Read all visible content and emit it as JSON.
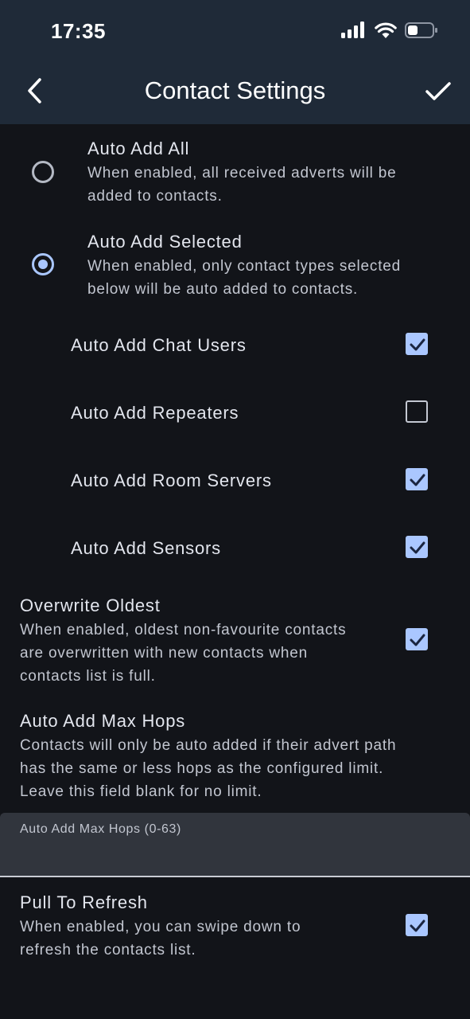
{
  "status_bar": {
    "time": "17:35"
  },
  "header": {
    "title": "Contact Settings",
    "back_icon": "chevron-left-icon",
    "confirm_icon": "checkmark-icon"
  },
  "auto_add_mode": {
    "selected": "auto_add_selected",
    "options": [
      {
        "title": "Auto Add All",
        "desc_line1": "When enabled, all received adverts will be",
        "desc_line2": "added to contacts.",
        "selected": false
      },
      {
        "title": "Auto Add Selected",
        "desc_line1": "When enabled, only contact types selected",
        "desc_line2": "below will be auto added to contacts.",
        "selected": true
      }
    ]
  },
  "contact_types": [
    {
      "label": "Auto Add Chat Users",
      "checked": true
    },
    {
      "label": "Auto Add Repeaters",
      "checked": false
    },
    {
      "label": "Auto Add Room Servers",
      "checked": true
    },
    {
      "label": "Auto Add Sensors",
      "checked": true
    }
  ],
  "overwrite_oldest": {
    "title": "Overwrite Oldest",
    "desc_line1": "When enabled, oldest non-favourite contacts",
    "desc_line2": "are overwritten with new contacts when",
    "desc_line3": "contacts list is full.",
    "checked": true
  },
  "max_hops": {
    "title": "Auto Add Max Hops",
    "desc_line1": "Contacts will only be auto added if their advert path",
    "desc_line2": "has the same or less hops as the configured limit.",
    "desc_line3": "Leave this field blank for no limit.",
    "field_label": "Auto Add Max Hops (0-63)",
    "value": ""
  },
  "pull_to_refresh": {
    "title": "Pull To Refresh",
    "desc_line1": "When enabled, you can swipe down to",
    "desc_line2": "refresh the contacts list.",
    "checked": true
  },
  "colors": {
    "accent": "#aac7ff",
    "header_bg": "#1f2a38",
    "page_bg": "#121419",
    "field_bg": "#31353d"
  }
}
